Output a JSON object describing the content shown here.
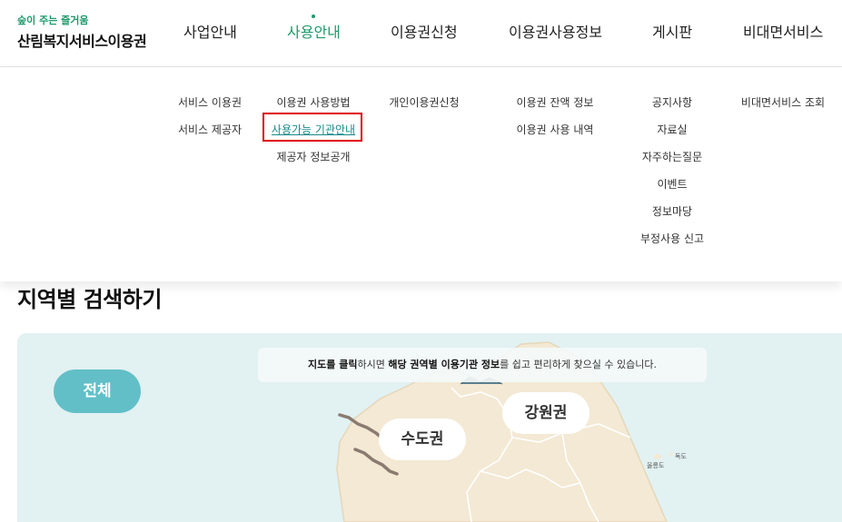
{
  "header": {
    "logo_tagline": "숲이 주는 즐거움",
    "logo_title": "산림복지서비스이용권",
    "nav": [
      {
        "label": "사업안내"
      },
      {
        "label": "사용안내"
      },
      {
        "label": "이용권신청"
      },
      {
        "label": "이용권사용정보"
      },
      {
        "label": "게시판"
      },
      {
        "label": "비대면서비스"
      }
    ],
    "active_nav": "사용안내",
    "accent_color": "#1e9a6a"
  },
  "submenu": {
    "business": [
      "서비스 이용권",
      "서비스 제공자"
    ],
    "usage": [
      "이용권 사용방법",
      "사용가능 기관안내",
      "제공자 정보공개"
    ],
    "apply": [
      "개인이용권신청"
    ],
    "usage_info": [
      "이용권 잔액 정보",
      "이용권 사용 내역"
    ],
    "board": [
      "공지사항",
      "자료실",
      "자주하는질문",
      "이벤트",
      "정보마당",
      "부정사용 신고"
    ],
    "contactless": [
      "비대면서비스 조회"
    ],
    "highlighted_item": "사용가능 기관안내"
  },
  "page": {
    "section_title": "지역별 검색하기",
    "info_prefix": "지도를 클릭",
    "info_mid1": "하시면 ",
    "info_bold": "해당 권역별 이용기관 정보",
    "info_suffix": "를 쉽고 편리하게 찾으실 수 있습니다.",
    "all_button": "전체",
    "regions": [
      "수도권",
      "강원권"
    ],
    "islands": [
      "울릉도",
      "독도"
    ],
    "map_bg_color": "#e2f1f2",
    "button_color": "#62bfc7"
  }
}
